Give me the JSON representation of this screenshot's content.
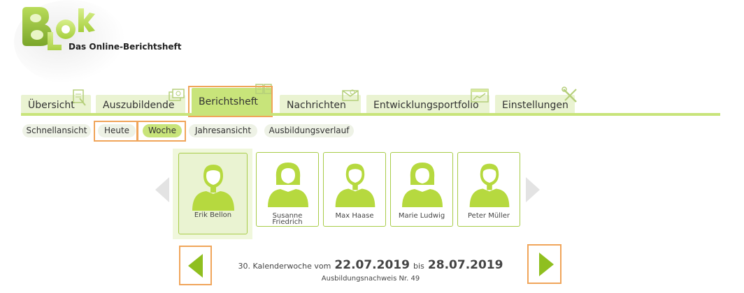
{
  "brand": {
    "logo_letters": [
      "B",
      "L",
      "o",
      "k"
    ],
    "tagline": "Das Online-Berichtsheft",
    "accent_color": "#c8e47a",
    "highlight_color": "#f0a55a"
  },
  "tabs": [
    {
      "label": "Übersicht",
      "icon": "clipboard-icon",
      "active": false
    },
    {
      "label": "Auszubildende",
      "icon": "folder-stack-icon",
      "active": false
    },
    {
      "label": "Berichtsheft",
      "icon": "book-icon",
      "active": true
    },
    {
      "label": "Nachrichten",
      "icon": "envelope-icon",
      "active": false
    },
    {
      "label": "Entwicklungsportfolio",
      "icon": "chart-icon",
      "active": false
    },
    {
      "label": "Einstellungen",
      "icon": "tools-icon",
      "active": false
    }
  ],
  "subtabs": [
    {
      "label": "Schnellansicht",
      "active": false
    },
    {
      "label": "Heute",
      "active": false
    },
    {
      "label": "Woche",
      "active": true
    },
    {
      "label": "Jahresansicht",
      "active": false
    },
    {
      "label": "Ausbildungsverlauf",
      "active": false
    }
  ],
  "trainees": [
    {
      "name": "Erik Bellon",
      "gender": "male",
      "selected": true
    },
    {
      "name": "Susanne Friedrich",
      "name_line1": "Susanne",
      "name_line2": "Friedrich",
      "gender": "female",
      "selected": false
    },
    {
      "name": "Max Haase",
      "gender": "male",
      "selected": false
    },
    {
      "name": "Marie Ludwig",
      "gender": "female",
      "selected": false
    },
    {
      "name": "Peter Müller",
      "gender": "male",
      "selected": false
    }
  ],
  "period": {
    "week_label": "30. Kalenderwoche vom",
    "start_date": "22.07.2019",
    "connector": "bis",
    "end_date": "28.07.2019",
    "report_label": "Ausbildungsnachweis Nr. 49"
  }
}
